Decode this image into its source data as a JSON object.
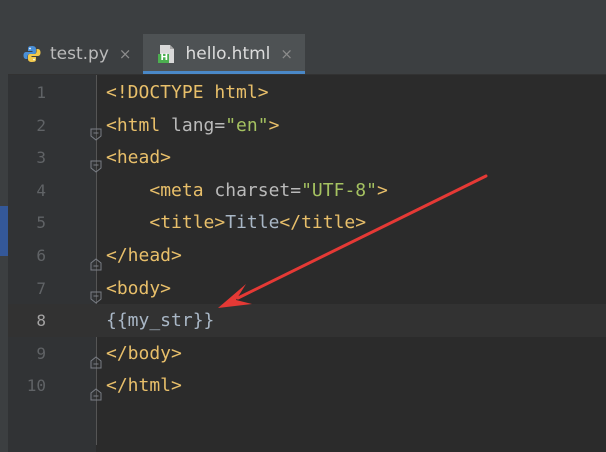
{
  "tabs": [
    {
      "name": "test.py",
      "close": "×",
      "active": false,
      "icon": "python-file-icon"
    },
    {
      "name": "hello.html",
      "close": "×",
      "active": true,
      "icon": "html-file-icon"
    }
  ],
  "html_icon_letter": "H",
  "lines": [
    {
      "num": "1",
      "indent": "",
      "tokens": [
        {
          "t": "tag",
          "v": "<!DOCTYPE html>"
        }
      ]
    },
    {
      "num": "2",
      "indent": "",
      "tokens": [
        {
          "t": "tag",
          "v": "<html "
        },
        {
          "t": "attr",
          "v": "lang="
        },
        {
          "t": "val",
          "v": "\"en\""
        },
        {
          "t": "tag",
          "v": ">"
        }
      ]
    },
    {
      "num": "3",
      "indent": "",
      "tokens": [
        {
          "t": "tag",
          "v": "<head>"
        }
      ]
    },
    {
      "num": "4",
      "indent": "    ",
      "tokens": [
        {
          "t": "tag",
          "v": "<meta "
        },
        {
          "t": "attr",
          "v": "charset="
        },
        {
          "t": "val",
          "v": "\"UTF-8\""
        },
        {
          "t": "tag",
          "v": ">"
        }
      ]
    },
    {
      "num": "5",
      "indent": "    ",
      "tokens": [
        {
          "t": "tag",
          "v": "<title>"
        },
        {
          "t": "txt",
          "v": "Title"
        },
        {
          "t": "tag",
          "v": "</title>"
        }
      ]
    },
    {
      "num": "6",
      "indent": "",
      "tokens": [
        {
          "t": "tag",
          "v": "</head>"
        }
      ]
    },
    {
      "num": "7",
      "indent": "",
      "tokens": [
        {
          "t": "tag",
          "v": "<body>"
        }
      ]
    },
    {
      "num": "8",
      "indent": "",
      "tokens": [
        {
          "t": "txt",
          "v": "{{my_str}}"
        }
      ]
    },
    {
      "num": "9",
      "indent": "",
      "tokens": [
        {
          "t": "tag",
          "v": "</body>"
        }
      ]
    },
    {
      "num": "10",
      "indent": "",
      "tokens": [
        {
          "t": "tag",
          "v": "</html>"
        }
      ]
    }
  ],
  "current_line": "8",
  "colors": {
    "tag": "#e8bf6a",
    "attr": "#bababa",
    "value": "#a5c261",
    "text": "#a9b7c6",
    "annotation_arrow": "#e53935"
  }
}
